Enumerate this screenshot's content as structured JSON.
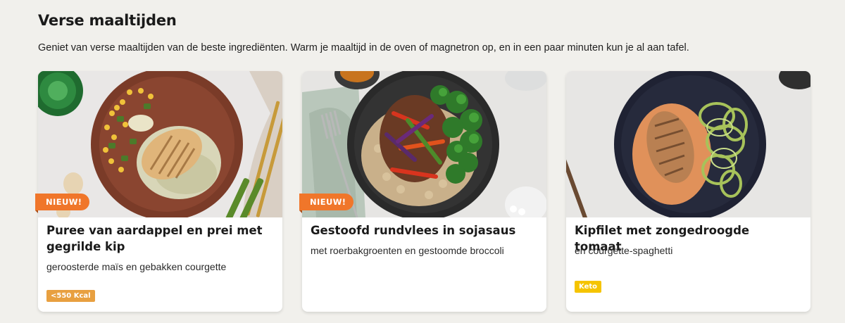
{
  "section": {
    "title": "Verse maaltijden",
    "intro": "Geniet van verse maaltijden van de beste ingrediënten. Warm je maaltijd in de oven of magnetron op, en in een paar minuten kun je al aan tafel."
  },
  "cards": [
    {
      "badge": "NIEUW!",
      "title": "Puree van aardappel en prei met gegrilde kip",
      "subtitle": "geroosterde maïs en gebakken courgette",
      "tag": "<550 Kcal",
      "tag_color": "#e8a040"
    },
    {
      "badge": "NIEUW!",
      "title": "Gestoofd rundvlees in sojasaus",
      "subtitle": "met roerbakgroenten en gestoomde broccoli"
    },
    {
      "title": "Kipfilet met zongedroogde tomaat",
      "subtitle": "en courgette-spaghetti",
      "tag": "Keto",
      "tag_color": "#f5c400"
    }
  ],
  "colors": {
    "background": "#f1f0ec",
    "badge_new": "#f0762a"
  }
}
